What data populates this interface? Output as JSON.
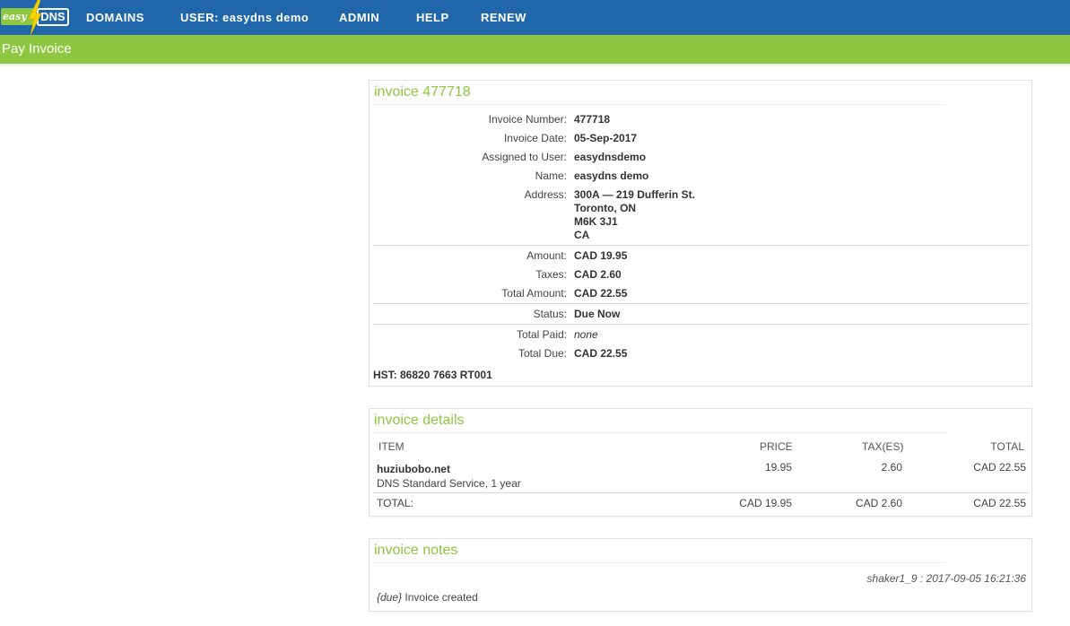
{
  "nav": {
    "logo_easy": "easy",
    "logo_dns": "DNS",
    "items": [
      "DOMAINS",
      "USER: easydns demo",
      "ADMIN",
      "HELP",
      "RENEW"
    ]
  },
  "page_title": "Pay Invoice",
  "invoice": {
    "title": "invoice 477718",
    "labels": {
      "number": "Invoice Number:",
      "date": "Invoice Date:",
      "assigned": "Assigned to User:",
      "name": "Name:",
      "address": "Address:",
      "amount": "Amount:",
      "taxes": "Taxes:",
      "total_amount": "Total Amount:",
      "status": "Status:",
      "total_paid": "Total Paid:",
      "total_due": "Total Due:"
    },
    "values": {
      "number": "477718",
      "date": "05-Sep-2017",
      "assigned": "easydnsdemo",
      "name": "easydns demo",
      "address": [
        "300A — 219 Dufferin St.",
        "Toronto, ON",
        "M6K 3J1",
        "CA"
      ],
      "amount": "CAD 19.95",
      "taxes": "CAD 2.60",
      "total_amount": "CAD 22.55",
      "status": "Due Now",
      "total_paid": "none",
      "total_due": "CAD 22.55"
    },
    "hst": "HST: 86820 7663 RT001"
  },
  "details": {
    "title": "invoice details",
    "headers": {
      "item": "ITEM",
      "price": "PRICE",
      "tax": "TAX(ES)",
      "total": "TOTAL"
    },
    "rows": [
      {
        "item": "huziubobo.net",
        "desc": "DNS Standard Service, 1 year",
        "price": "19.95",
        "tax": "2.60",
        "total": "CAD 22.55"
      }
    ],
    "footer": {
      "label": "TOTAL:",
      "price": "CAD 19.95",
      "tax": "CAD 2.60",
      "total": "CAD 22.55"
    }
  },
  "notes": {
    "title": "invoice notes",
    "meta": "shaker1_9 : 2017-09-05 16:21:36",
    "tag": "{due}",
    "text": "Invoice created"
  },
  "colors": {
    "nav_blue": "#1f66aa",
    "brand_green": "#8dc63f",
    "bolt_yellow": "#f5d300"
  }
}
